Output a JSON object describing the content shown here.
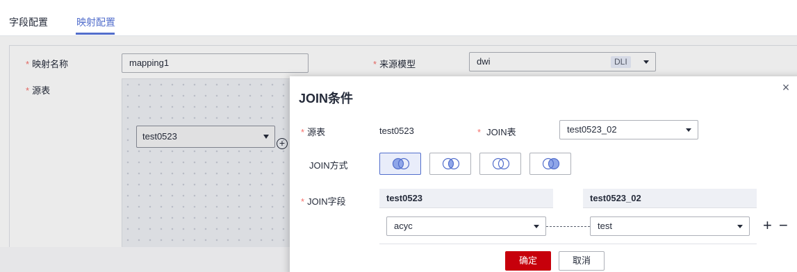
{
  "tabs": [
    {
      "label": "字段配置"
    },
    {
      "label": "映射配置"
    }
  ],
  "form": {
    "mapping_name_label": "映射名称",
    "mapping_name_value": "mapping1",
    "source_model_label": "来源模型",
    "source_model_value": "dwi",
    "source_model_tag": "DLI",
    "source_table_label": "源表",
    "source_table_node": "test0523"
  },
  "dialog": {
    "title": "JOIN条件",
    "source_table_label": "源表",
    "source_table_value": "test0523",
    "join_table_label": "JOIN表",
    "join_table_value": "test0523_02",
    "join_type_label": "JOIN方式",
    "join_types": [
      "left-join",
      "inner-join",
      "full-join",
      "right-join"
    ],
    "active_join_type": "left-join",
    "join_field_label": "JOIN字段",
    "left_column_header": "test0523",
    "right_column_header": "test0523_02",
    "left_field_value": "acyc",
    "right_field_value": "test",
    "ok_label": "确定",
    "cancel_label": "取消"
  },
  "colors": {
    "accent": "#526ecc",
    "primary_button": "#c7000b",
    "required": "#f66f6a"
  }
}
